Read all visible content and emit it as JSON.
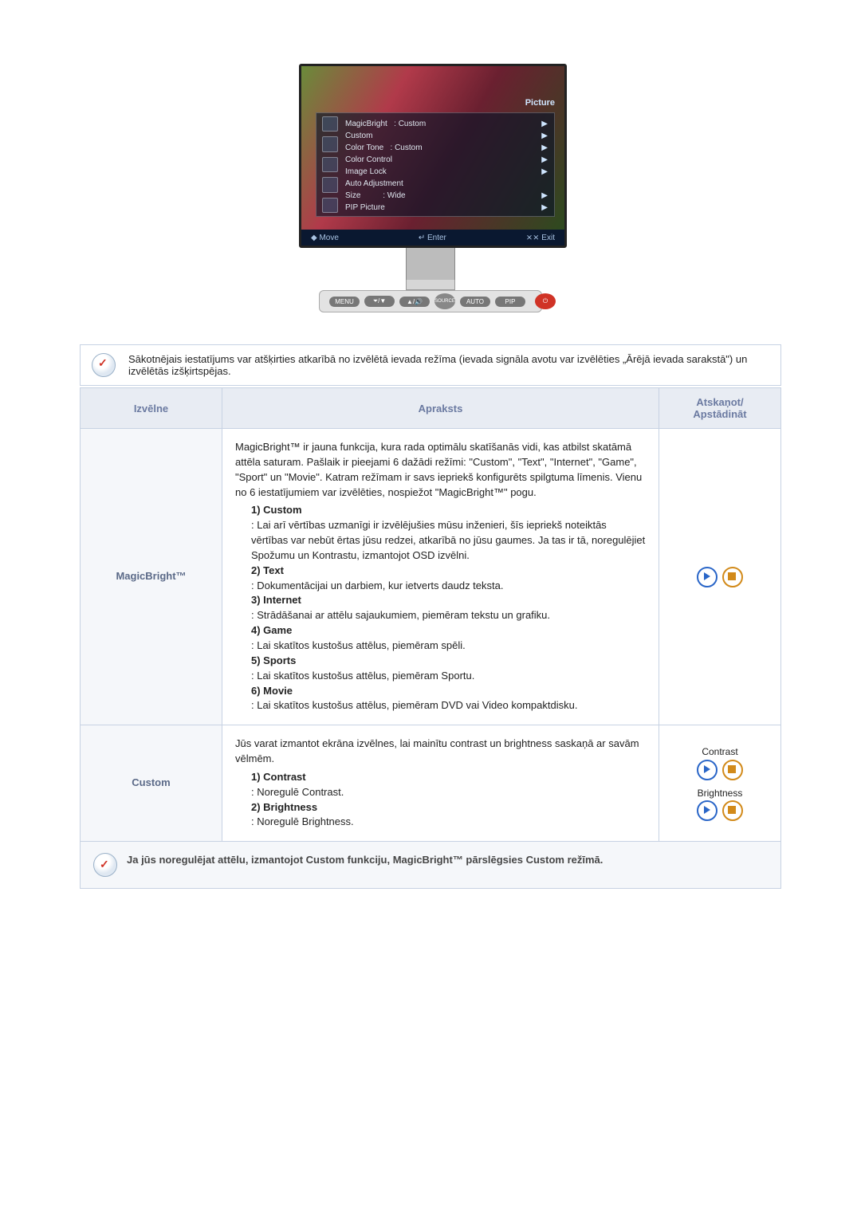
{
  "osd": {
    "title": "Picture",
    "items": [
      {
        "label": "MagicBright",
        "value": ": Custom",
        "arrow": "▶"
      },
      {
        "label": "Custom",
        "value": "",
        "arrow": "▶"
      },
      {
        "label": "Color Tone",
        "value": ": Custom",
        "arrow": "▶"
      },
      {
        "label": "Color Control",
        "value": "",
        "arrow": "▶"
      },
      {
        "label": "Image Lock",
        "value": "",
        "arrow": "▶"
      },
      {
        "label": "Auto Adjustment",
        "value": "",
        "arrow": ""
      },
      {
        "label": "Size",
        "value": ": Wide",
        "arrow": "▶"
      },
      {
        "label": "PIP Picture",
        "value": "",
        "arrow": "▶"
      }
    ],
    "foot_move": "◆ Move",
    "foot_enter": "↵ Enter",
    "foot_exit": "⨯⨯ Exit"
  },
  "buttons": {
    "menu": "MENU",
    "down": "",
    "up": "",
    "source": "SOURCE",
    "auto": "AUTO",
    "pip": "PIP",
    "power": "⏻"
  },
  "note_top": "Sākotnējais iestatījums var atšķirties atkarībā no izvēlētā ievada režīma (ievada signāla avotu var izvēlēties „Ārējā ievada sarakstā\") un izvēlētās izšķirtspējas.",
  "headers": {
    "menu": "Izvēlne",
    "desc": "Apraksts",
    "play": "Atskaņot/ Apstādināt"
  },
  "rows": {
    "magicbright": {
      "name": "MagicBright™",
      "intro": "MagicBright™ ir jauna funkcija, kura rada optimālu skatīšanās vidi, kas atbilst skatāmā attēla saturam. Pašlaik ir pieejami 6 dažādi režīmi: \"Custom\", \"Text\", \"Internet\", \"Game\", \"Sport\" un \"Movie\". Katram režīmam ir savs iepriekš konfigurēts spilgtuma līmenis. Vienu no 6 iestatījumiem var izvēlēties, nospiežot \"MagicBright™\" pogu.",
      "modes": [
        {
          "num": "1) Custom",
          "text": ": Lai arī vērtības uzmanīgi ir izvēlējušies mūsu inženieri, šīs iepriekš noteiktās vērtības var nebūt ērtas jūsu redzei, atkarībā no jūsu gaumes. Ja tas ir tā, noregulējiet Spožumu un Kontrastu, izmantojot OSD izvēlni."
        },
        {
          "num": "2) Text",
          "text": ": Dokumentācijai un darbiem, kur ietverts daudz teksta."
        },
        {
          "num": "3) Internet",
          "text": ": Strādāšanai ar attēlu sajaukumiem, piemēram tekstu un grafiku."
        },
        {
          "num": "4) Game",
          "text": ": Lai skatītos kustošus attēlus, piemēram spēli."
        },
        {
          "num": "5) Sports",
          "text": ": Lai skatītos kustošus attēlus, piemēram Sportu."
        },
        {
          "num": "6) Movie",
          "text": ": Lai skatītos kustošus attēlus, piemēram DVD vai Video kompaktdisku."
        }
      ]
    },
    "custom": {
      "name": "Custom",
      "intro": "Jūs varat izmantot ekrāna izvēlnes, lai mainītu contrast un brightness saskaņā ar savām vēlmēm.",
      "modes": [
        {
          "num": "1) Contrast",
          "text": ": Noregulē Contrast."
        },
        {
          "num": "2) Brightness",
          "text": ": Noregulē Brightness."
        }
      ],
      "labels": {
        "contrast": "Contrast",
        "brightness": "Brightness"
      }
    }
  },
  "footnote": "Ja jūs noregulējat attēlu, izmantojot Custom funkciju, MagicBright™ pārslēgsies Custom režīmā."
}
